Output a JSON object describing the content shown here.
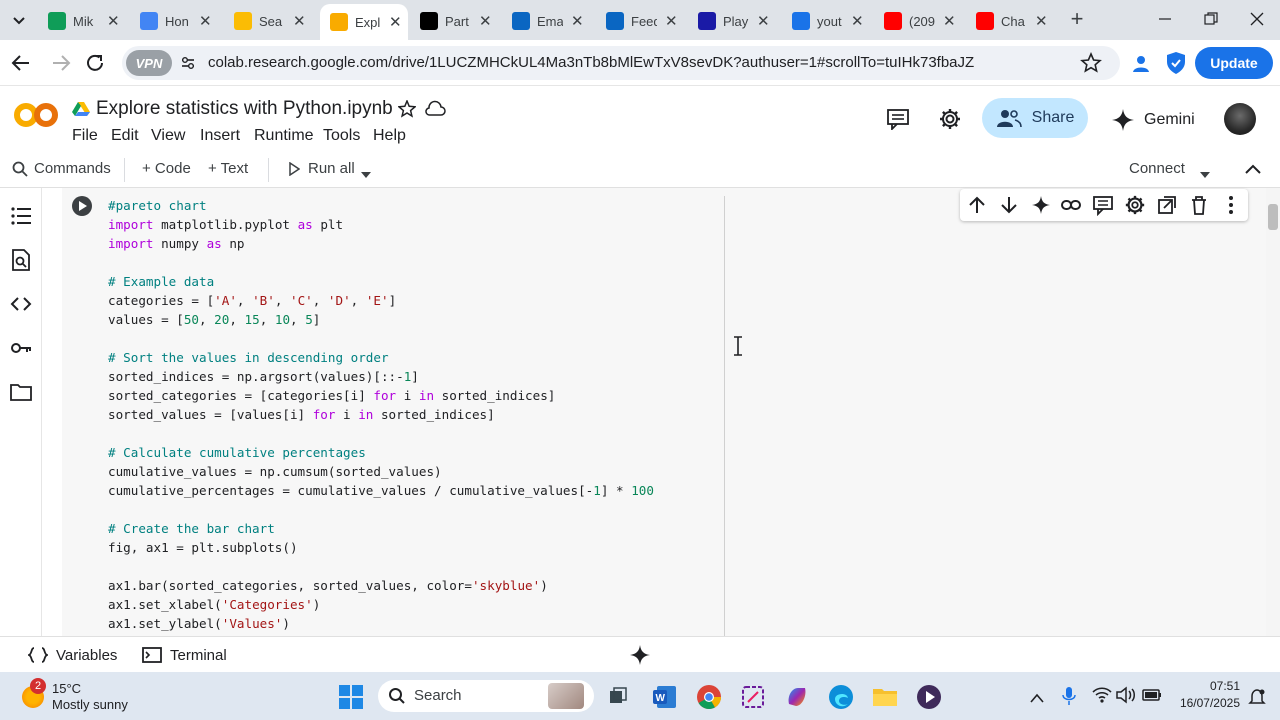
{
  "browser": {
    "tabs": [
      {
        "label": "Mik",
        "icon": "sheets-icon",
        "color": "#0f9d58"
      },
      {
        "label": "Hon",
        "icon": "drive-icon",
        "color": "#4285f4"
      },
      {
        "label": "Sea",
        "icon": "drive-icon",
        "color": "#fbbc04"
      },
      {
        "label": "Expl",
        "icon": "colab-icon",
        "color": "#f9ab00",
        "active": true
      },
      {
        "label": "Part",
        "icon": "medium-icon",
        "color": "#000000"
      },
      {
        "label": "Ema",
        "icon": "outlook-icon",
        "color": "#0a66c2"
      },
      {
        "label": "Feed",
        "icon": "linkedin-icon",
        "color": "#0a66c2"
      },
      {
        "label": "Play",
        "icon": "k-icon",
        "color": "#1a1aa6"
      },
      {
        "label": "yout",
        "icon": "search-icon",
        "color": "#1a73e8"
      },
      {
        "label": "(209",
        "icon": "youtube-icon",
        "color": "#ff0000"
      },
      {
        "label": "Cha",
        "icon": "youtube-icon",
        "color": "#ff0000"
      }
    ],
    "vpn_label": "VPN",
    "url": "colab.research.google.com/drive/1LUCZMHCkUL4Ma3nTb8bMlEwTxV8sevDK?authuser=1#scrollTo=tuIHk73fbaJZ",
    "update_label": "Update"
  },
  "colab": {
    "logo_text": "CO",
    "notebook_title": "Explore statistics with Python.ipynb",
    "menu": [
      "File",
      "Edit",
      "View",
      "Insert",
      "Runtime",
      "Tools",
      "Help"
    ],
    "share_label": "Share",
    "gemini_label": "Gemini",
    "toolbar": {
      "commands": "Commands",
      "code": "+ Code",
      "text": "+ Text",
      "run_all": "Run all",
      "connect": "Connect"
    },
    "bottom": {
      "variables": "Variables",
      "terminal": "Terminal"
    }
  },
  "code_lines": [
    [
      {
        "t": "#pareto chart",
        "c": "cm"
      }
    ],
    [
      {
        "t": "import",
        "c": "kw"
      },
      {
        "t": " matplotlib.pyplot ",
        "c": ""
      },
      {
        "t": "as",
        "c": "kw"
      },
      {
        "t": " plt",
        "c": ""
      }
    ],
    [
      {
        "t": "import",
        "c": "kw"
      },
      {
        "t": " numpy ",
        "c": ""
      },
      {
        "t": "as",
        "c": "kw"
      },
      {
        "t": " np",
        "c": ""
      }
    ],
    [],
    [
      {
        "t": "# Example data",
        "c": "cm"
      }
    ],
    [
      {
        "t": "categories = [",
        "c": ""
      },
      {
        "t": "'A'",
        "c": "str"
      },
      {
        "t": ", ",
        "c": ""
      },
      {
        "t": "'B'",
        "c": "str"
      },
      {
        "t": ", ",
        "c": ""
      },
      {
        "t": "'C'",
        "c": "str"
      },
      {
        "t": ", ",
        "c": ""
      },
      {
        "t": "'D'",
        "c": "str"
      },
      {
        "t": ", ",
        "c": ""
      },
      {
        "t": "'E'",
        "c": "str"
      },
      {
        "t": "]",
        "c": ""
      }
    ],
    [
      {
        "t": "values = [",
        "c": ""
      },
      {
        "t": "50",
        "c": "num"
      },
      {
        "t": ", ",
        "c": ""
      },
      {
        "t": "20",
        "c": "num"
      },
      {
        "t": ", ",
        "c": ""
      },
      {
        "t": "15",
        "c": "num"
      },
      {
        "t": ", ",
        "c": ""
      },
      {
        "t": "10",
        "c": "num"
      },
      {
        "t": ", ",
        "c": ""
      },
      {
        "t": "5",
        "c": "num"
      },
      {
        "t": "]",
        "c": ""
      }
    ],
    [],
    [
      {
        "t": "# Sort the values in descending order",
        "c": "cm"
      }
    ],
    [
      {
        "t": "sorted_indices = np.argsort(values)[::-",
        "c": ""
      },
      {
        "t": "1",
        "c": "num"
      },
      {
        "t": "]",
        "c": ""
      }
    ],
    [
      {
        "t": "sorted_categories = [categories[i] ",
        "c": ""
      },
      {
        "t": "for",
        "c": "kw"
      },
      {
        "t": " i ",
        "c": ""
      },
      {
        "t": "in",
        "c": "kw"
      },
      {
        "t": " sorted_indices]",
        "c": ""
      }
    ],
    [
      {
        "t": "sorted_values = [values[i] ",
        "c": ""
      },
      {
        "t": "for",
        "c": "kw"
      },
      {
        "t": " i ",
        "c": ""
      },
      {
        "t": "in",
        "c": "kw"
      },
      {
        "t": " sorted_indices]",
        "c": ""
      }
    ],
    [],
    [
      {
        "t": "# Calculate cumulative percentages",
        "c": "cm"
      }
    ],
    [
      {
        "t": "cumulative_values = np.cumsum(sorted_values)",
        "c": ""
      }
    ],
    [
      {
        "t": "cumulative_percentages = cumulative_values / cumulative_values[-",
        "c": ""
      },
      {
        "t": "1",
        "c": "num"
      },
      {
        "t": "] * ",
        "c": ""
      },
      {
        "t": "100",
        "c": "num"
      }
    ],
    [],
    [
      {
        "t": "# Create the bar chart",
        "c": "cm"
      }
    ],
    [
      {
        "t": "fig, ax1 = plt.subplots()",
        "c": ""
      }
    ],
    [],
    [
      {
        "t": "ax1.bar(sorted_categories, sorted_values, color=",
        "c": ""
      },
      {
        "t": "'skyblue'",
        "c": "str"
      },
      {
        "t": ")",
        "c": ""
      }
    ],
    [
      {
        "t": "ax1.set_xlabel(",
        "c": ""
      },
      {
        "t": "'Categories'",
        "c": "str"
      },
      {
        "t": ")",
        "c": ""
      }
    ],
    [
      {
        "t": "ax1.set_ylabel(",
        "c": ""
      },
      {
        "t": "'Values'",
        "c": "str"
      },
      {
        "t": ")",
        "c": ""
      }
    ]
  ],
  "taskbar": {
    "weather_temp": "15°C",
    "weather_desc": "Mostly sunny",
    "weather_badge": "2",
    "search_label": "Search",
    "time": "07:51",
    "date": "16/07/2025"
  }
}
